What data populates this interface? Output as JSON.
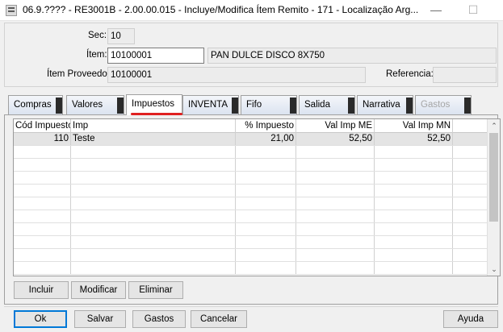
{
  "window": {
    "title": "06.9.???? - RE3001B - 2.00.00.015 - Incluye/Modifica Ítem Remito - 171 - Localização Arg...",
    "minimize": "—",
    "maximize": "☐"
  },
  "header": {
    "sec_label": "Sec:",
    "sec_value": "10",
    "item_label": "Ítem:",
    "item_value": "10100001",
    "item_desc": "PAN DULCE DISCO 8X750",
    "proveedor_label": "Ítem Proveedor:",
    "proveedor_value": "10100001",
    "referencia_label": "Referencia:",
    "referencia_value": ""
  },
  "tabs": [
    {
      "label": "Compras",
      "state": "normal"
    },
    {
      "label": "Valores",
      "state": "normal"
    },
    {
      "label": "Impuestos",
      "state": "active"
    },
    {
      "label": "INVENTA",
      "state": "normal"
    },
    {
      "label": "Fifo",
      "state": "normal"
    },
    {
      "label": "Salida",
      "state": "normal"
    },
    {
      "label": "Narrativa",
      "state": "normal"
    },
    {
      "label": "Gastos",
      "state": "disabled"
    }
  ],
  "grid": {
    "columns": [
      "Cód Impuesto",
      "Imp",
      "% Impuesto",
      "Val Imp ME",
      "Val Imp MN"
    ],
    "rows": [
      [
        "110",
        "Teste",
        "21,00",
        "52,50",
        "52,50"
      ]
    ],
    "scroll_down_icon": "⌄",
    "scroll_up_icon": "⌃"
  },
  "grid_buttons": {
    "incluir": "Incluir",
    "modificar": "Modificar",
    "eliminar": "Eliminar"
  },
  "footer": {
    "ok": "Ok",
    "salvar": "Salvar",
    "gastos": "Gastos",
    "cancelar": "Cancelar",
    "ayuda": "Ayuda"
  },
  "colors": {
    "active_tab_marker": "#e02020",
    "focus_border": "#0078d7"
  }
}
